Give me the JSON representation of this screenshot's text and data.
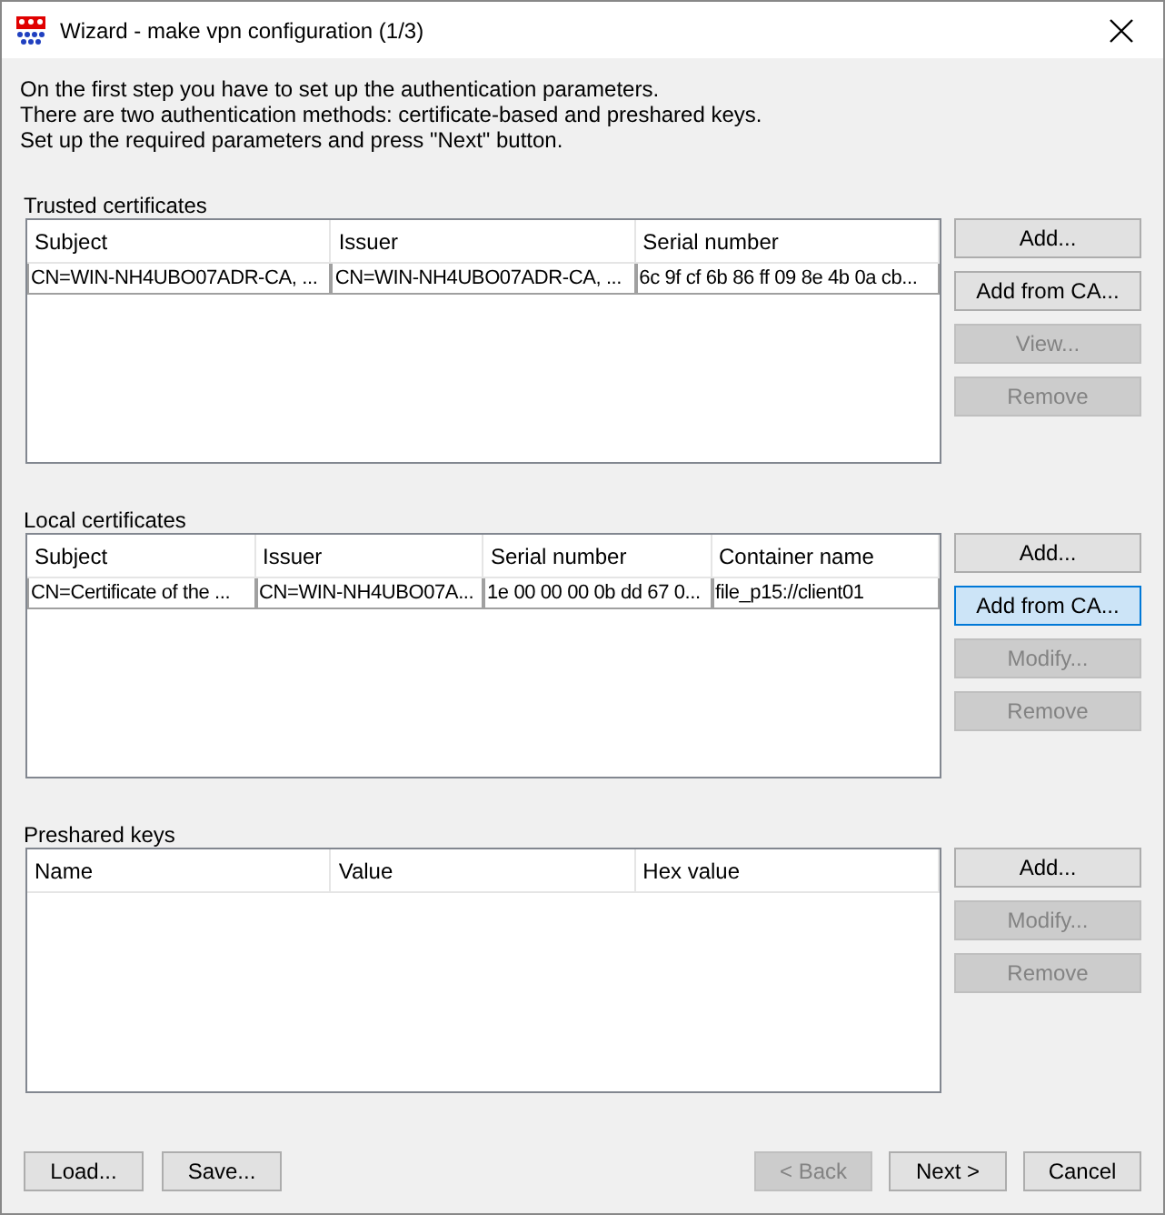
{
  "window": {
    "title": "Wizard - make vpn configuration (1/3)"
  },
  "intro": [
    "On the first step you have to set up the authentication parameters.",
    "There are two authentication methods: certificate-based and preshared keys.",
    "Set up the required parameters and press \"Next\" button."
  ],
  "sections": [
    {
      "title": "Trusted certificates",
      "columns": [
        "Subject",
        "Issuer",
        "Serial number"
      ],
      "rows": [
        [
          "CN=WIN-NH4UBO07ADR-CA, ...",
          "CN=WIN-NH4UBO07ADR-CA, ...",
          "6c 9f cf 6b 86 ff 09 8e 4b 0a cb..."
        ]
      ],
      "buttons": [
        {
          "label": "Add...",
          "disabled": false,
          "focused": false
        },
        {
          "label": "Add from CA...",
          "disabled": false,
          "focused": false
        },
        {
          "label": "View...",
          "disabled": true,
          "focused": false
        },
        {
          "label": "Remove",
          "disabled": true,
          "focused": false
        }
      ]
    },
    {
      "title": "Local certificates",
      "columns": [
        "Subject",
        "Issuer",
        "Serial number",
        "Container name"
      ],
      "rows": [
        [
          "CN=Certificate of the ...",
          "CN=WIN-NH4UBO07A...",
          "1e 00 00 00 0b dd 67 0...",
          "file_p15://client01"
        ]
      ],
      "buttons": [
        {
          "label": "Add...",
          "disabled": false,
          "focused": false
        },
        {
          "label": "Add from CA...",
          "disabled": false,
          "focused": true
        },
        {
          "label": "Modify...",
          "disabled": true,
          "focused": false
        },
        {
          "label": "Remove",
          "disabled": true,
          "focused": false
        }
      ]
    },
    {
      "title": "Preshared keys",
      "columns": [
        "Name",
        "Value",
        "Hex value"
      ],
      "buttons": [
        {
          "label": "Add...",
          "disabled": false,
          "focused": false
        },
        {
          "label": "Modify...",
          "disabled": true,
          "focused": false
        },
        {
          "label": "Remove",
          "disabled": true,
          "focused": false
        }
      ]
    }
  ],
  "footer_left": [
    {
      "label": "Load...",
      "disabled": false
    },
    {
      "label": "Save...",
      "disabled": false
    }
  ],
  "footer_right": [
    {
      "label": "< Back",
      "disabled": true
    },
    {
      "label": "Next >",
      "disabled": false
    },
    {
      "label": "Cancel",
      "disabled": false
    }
  ]
}
